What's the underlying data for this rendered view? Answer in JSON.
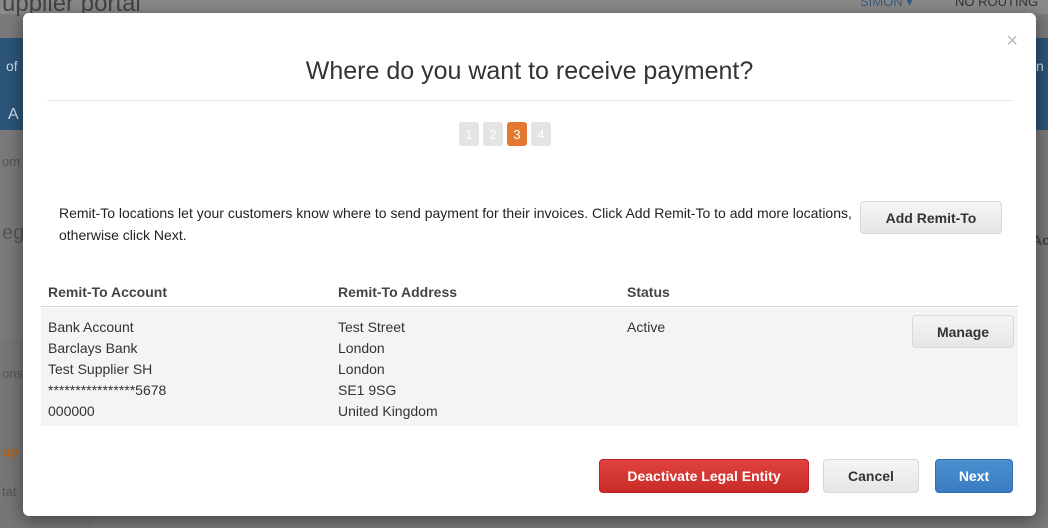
{
  "background": {
    "title_fragment": "upplier portal",
    "user": "SIMON ▾",
    "location": "NO ROUTING",
    "nav_fragment_1": "of",
    "nav_fragment_2": "A",
    "right_fragment": "n",
    "left_fragments": [
      "om",
      "eg",
      "ons",
      "up",
      "tat"
    ],
    "right_ad": "Ac"
  },
  "modal": {
    "title": "Where do you want to receive payment?",
    "close_icon": "×",
    "steps": [
      "1",
      "2",
      "3",
      "4"
    ],
    "active_step": "3",
    "intro_text": "Remit-To locations let your customers know where to send payment for their invoices. Click Add Remit-To to add more locations, otherwise click Next.",
    "add_button": "Add Remit-To",
    "table": {
      "headers": [
        "Remit-To Account",
        "Remit-To Address",
        "Status"
      ],
      "rows": [
        {
          "account": [
            "Bank Account",
            "Barclays Bank",
            "Test Supplier SH",
            "****************5678",
            "000000"
          ],
          "address": [
            "Test Street",
            "London",
            "London",
            "SE1 9SG",
            "United Kingdom"
          ],
          "status": "Active",
          "action": "Manage"
        }
      ]
    },
    "footer": {
      "deactivate": "Deactivate Legal Entity",
      "cancel": "Cancel",
      "next": "Next"
    }
  },
  "colors": {
    "active_step": "#e27832",
    "danger": "#d0352f",
    "primary": "#3f84c6",
    "overlay_bg": "#7a7a7a"
  }
}
